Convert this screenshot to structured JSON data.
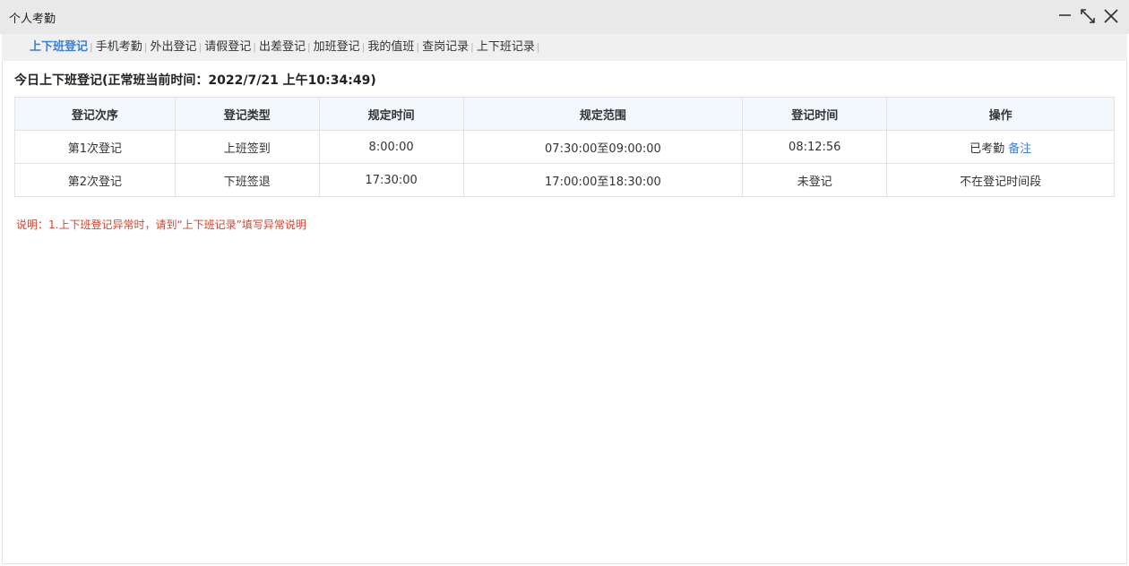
{
  "window": {
    "title": "个人考勤",
    "icons": {
      "minimize": "minimize-icon",
      "restore": "restore-icon",
      "close": "close-icon"
    }
  },
  "tabs": [
    {
      "label": "上下班登记",
      "active": true
    },
    {
      "label": "手机考勤",
      "active": false
    },
    {
      "label": "外出登记",
      "active": false
    },
    {
      "label": "请假登记",
      "active": false
    },
    {
      "label": "出差登记",
      "active": false
    },
    {
      "label": "加班登记",
      "active": false
    },
    {
      "label": "我的值班",
      "active": false
    },
    {
      "label": "查岗记录",
      "active": false
    },
    {
      "label": "上下班记录",
      "active": false
    }
  ],
  "tab_separator": "|",
  "heading": "今日上下班登记(正常班当前时间：2022/7/21 上午10:34:49)",
  "table": {
    "headers": [
      "登记次序",
      "登记类型",
      "规定时间",
      "规定范围",
      "登记时间",
      "操作"
    ],
    "rows": [
      {
        "order": "第1次登记",
        "type": "上班签到",
        "time": "8:00:00",
        "range": "07:30:00至09:00:00",
        "registered": "08:12:56",
        "action_text": "已考勤",
        "action_link": "备注"
      },
      {
        "order": "第2次登记",
        "type": "下班签退",
        "time": "17:30:00",
        "range": "17:00:00至18:30:00",
        "registered": "未登记",
        "action_text": "不在登记时间段",
        "action_link": ""
      }
    ]
  },
  "note": "说明：1.上下班登记异常时，请到“上下班记录”填写异常说明",
  "colors": {
    "accent": "#3a7fd5",
    "note": "#d0442f",
    "header_bg": "#f3f8fd",
    "titlebar_bg": "#e9e9e9"
  }
}
